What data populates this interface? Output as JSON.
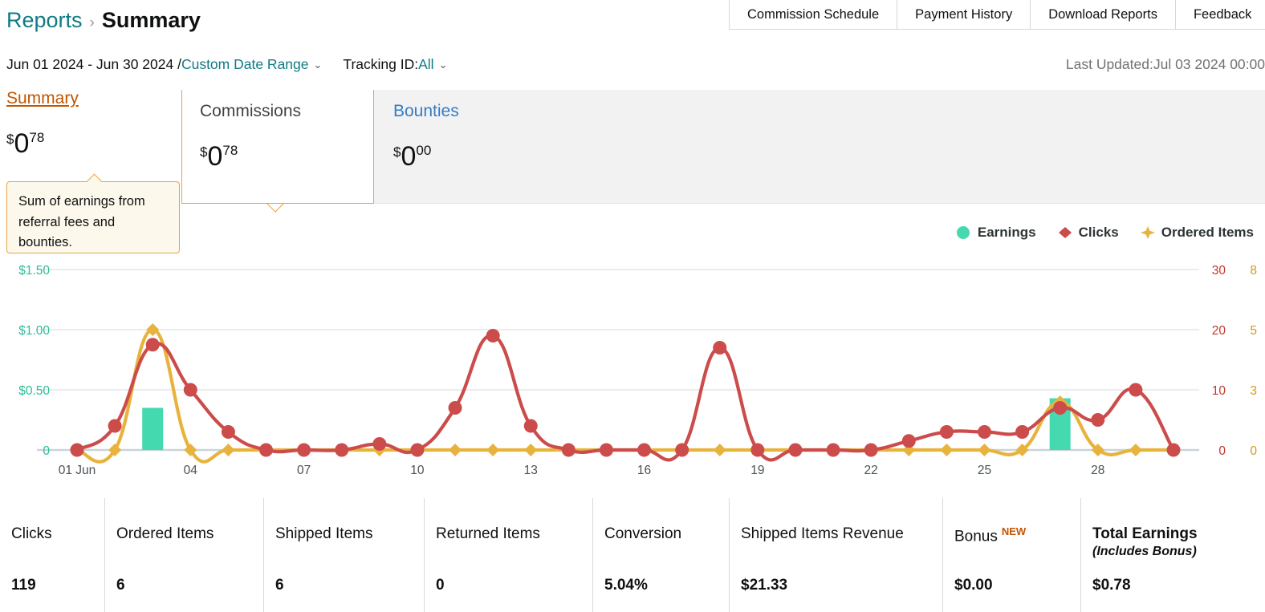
{
  "top_nav": {
    "items": [
      {
        "label": "Commission Schedule"
      },
      {
        "label": "Payment History"
      },
      {
        "label": "Download Reports"
      },
      {
        "label": "Feedback"
      }
    ]
  },
  "breadcrumb": {
    "parent": "Reports",
    "separator": "›",
    "current": "Summary"
  },
  "filters": {
    "date_range": "Jun 01 2024 - Jun 30 2024 /",
    "date_range_link": "Custom Date Range",
    "caret": "⌄",
    "tracking_label": "Tracking ID:",
    "tracking_value": "All",
    "last_updated": "Last Updated:Jul 03 2024 00:00"
  },
  "metric_tabs": [
    {
      "label": "Summary",
      "currency": "$",
      "integer": "0",
      "decimals": "78"
    },
    {
      "label": "Commissions",
      "currency": "$",
      "integer": "0",
      "decimals": "78"
    },
    {
      "label": "Bounties",
      "currency": "$",
      "integer": "0",
      "decimals": "00"
    }
  ],
  "tooltip": {
    "text": "Sum of earnings from referral fees and bounties."
  },
  "legend": [
    {
      "label": "Earnings",
      "color": "#45d9b0",
      "marker": "circle"
    },
    {
      "label": "Clicks",
      "color": "#cc4b4b",
      "marker": "diamond"
    },
    {
      "label": "Ordered Items",
      "color": "#e8b33d",
      "marker": "star"
    }
  ],
  "chart_data": {
    "type": "line",
    "title": "",
    "xlabel": "",
    "ylabel": "",
    "grid": true,
    "legend_position": "top-right",
    "x": [
      "01 Jun",
      "02",
      "03",
      "04",
      "05",
      "06",
      "07",
      "08",
      "09",
      "10",
      "11",
      "12",
      "13",
      "14",
      "15",
      "16",
      "17",
      "18",
      "19",
      "20",
      "21",
      "22",
      "23",
      "24",
      "25",
      "26",
      "27",
      "28",
      "29",
      "30"
    ],
    "x_tick_labels": [
      "01 Jun",
      "04",
      "07",
      "10",
      "13",
      "16",
      "19",
      "22",
      "25",
      "28"
    ],
    "x_tick_indices": [
      0,
      3,
      6,
      9,
      12,
      15,
      18,
      21,
      24,
      27
    ],
    "axes": {
      "earnings": {
        "ticks": [
          "0",
          "$0.50",
          "$1.00",
          "$1.50"
        ],
        "values": [
          0,
          0.5,
          1.0,
          1.5
        ],
        "lim": [
          0,
          1.5
        ],
        "color": "#2bbd9a"
      },
      "clicks": {
        "ticks": [
          "0",
          "10",
          "20",
          "30"
        ],
        "values": [
          0,
          10,
          20,
          30
        ],
        "lim": [
          0,
          30
        ],
        "color": "#c0392b"
      },
      "orders": {
        "ticks": [
          "0",
          "3",
          "5",
          "8"
        ],
        "values": [
          0,
          2.5,
          5,
          7.5
        ],
        "lim": [
          0,
          7.5
        ],
        "color": "#d29a1a"
      }
    },
    "series": [
      {
        "name": "Earnings",
        "type": "bar",
        "axis": "earnings",
        "color": "#45d9b0",
        "values": [
          0,
          0,
          0.35,
          0,
          0,
          0,
          0,
          0,
          0,
          0,
          0,
          0,
          0,
          0,
          0,
          0,
          0,
          0,
          0,
          0,
          0,
          0,
          0,
          0,
          0,
          0,
          0.43,
          0,
          0,
          0
        ]
      },
      {
        "name": "Clicks",
        "type": "line",
        "axis": "clicks",
        "color": "#cc4b4b",
        "values": [
          0,
          4,
          17.5,
          10,
          3,
          0,
          0,
          0,
          1,
          0,
          7,
          19,
          4,
          0,
          0,
          0,
          0,
          17,
          0,
          0,
          0,
          0,
          1.5,
          3,
          3,
          3,
          7,
          5,
          10,
          0
        ]
      },
      {
        "name": "Ordered Items",
        "type": "line",
        "axis": "orders",
        "color": "#e8b33d",
        "values": [
          0,
          0,
          5,
          0,
          0,
          0,
          0,
          0,
          0,
          0,
          0,
          0,
          0,
          0,
          0,
          0,
          0,
          0,
          0,
          0,
          0,
          0,
          0,
          0,
          0,
          0,
          2,
          0,
          0,
          0
        ]
      }
    ]
  },
  "summary_table": {
    "columns": [
      {
        "header": "Clicks",
        "value": "119"
      },
      {
        "header": "Ordered Items",
        "value": "6"
      },
      {
        "header": "Shipped Items",
        "value": "6"
      },
      {
        "header": "Returned Items",
        "value": "0"
      },
      {
        "header": "Conversion",
        "value": "5.04%"
      },
      {
        "header": "Shipped Items Revenue",
        "value": "$21.33"
      },
      {
        "header": "Bonus",
        "badge": "NEW",
        "value": "$0.00"
      },
      {
        "header": "Total Earnings",
        "sub": "(Includes Bonus)",
        "value": "$0.78"
      }
    ]
  }
}
